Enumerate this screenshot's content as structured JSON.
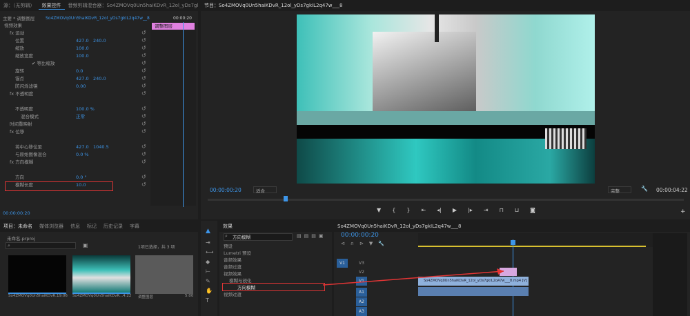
{
  "source_tabs": [
    "源：（无剪辑）",
    "效果控件",
    "音频剪辑混合器：So4ZMOVq0Un5haiKDvR_12ol_yDs7gk"
  ],
  "ec": {
    "master": "主要 * 调整图层",
    "clip": "So4ZMOVq0Un5haiKDvR_12ol_yDs7gkIL2q47w__8",
    "time_start": "00:00",
    "time_end": "00:00:20",
    "bar_label": "调整图层",
    "rows": [
      {
        "t": "视频效果",
        "i": 0,
        "v1": "",
        "v2": ""
      },
      {
        "t": "fx 运动",
        "i": 1,
        "v1": "",
        "v2": ""
      },
      {
        "t": "位置",
        "i": 2,
        "v1": "427.0",
        "v2": "240.0"
      },
      {
        "t": "缩放",
        "i": 2,
        "v1": "100.0",
        "v2": ""
      },
      {
        "t": "缩放宽度",
        "i": 2,
        "v1": "100.0",
        "v2": ""
      },
      {
        "t": "✔ 等比缩放",
        "i": 5,
        "v1": "",
        "v2": ""
      },
      {
        "t": "旋转",
        "i": 2,
        "v1": "0.0",
        "v2": ""
      },
      {
        "t": "锚点",
        "i": 2,
        "v1": "427.0",
        "v2": "240.0"
      },
      {
        "t": "防闪烁滤镜",
        "i": 2,
        "v1": "0.00",
        "v2": ""
      },
      {
        "t": "fx 不透明度",
        "i": 1,
        "v1": "",
        "v2": ""
      },
      {
        "t": "",
        "i": 2,
        "v1": "",
        "v2": ""
      },
      {
        "t": "不透明度",
        "i": 2,
        "v1": "100.0 %",
        "v2": ""
      },
      {
        "t": "混合模式",
        "i": 3,
        "v1": "正常",
        "v2": ""
      },
      {
        "t": "时间重映射",
        "i": 1,
        "v1": "",
        "v2": ""
      },
      {
        "t": "fx 位移",
        "i": 1,
        "v1": "",
        "v2": ""
      },
      {
        "t": "",
        "i": 2,
        "v1": "",
        "v2": ""
      },
      {
        "t": "将中心移位至",
        "i": 2,
        "v1": "427.0",
        "v2": "1040.5"
      },
      {
        "t": "与原始图像混合",
        "i": 2,
        "v1": "0.0 %",
        "v2": ""
      },
      {
        "t": "fx 方向模糊",
        "i": 1,
        "v1": "",
        "v2": ""
      },
      {
        "t": "",
        "i": 2,
        "v1": "",
        "v2": ""
      },
      {
        "t": "方向",
        "i": 2,
        "v1": "0.0 °",
        "v2": ""
      },
      {
        "t": "模糊长度",
        "i": 2,
        "v1": "10.0",
        "v2": ""
      }
    ],
    "footer_time": "00:00:00:20"
  },
  "program": {
    "title": "节目：So4ZMOVq0Un5haiKDvR_12ol_yDs7gkIL2q47w___8",
    "timecode": "00:00:00:20",
    "fit": "适合",
    "quality": "完整",
    "duration": "00:00:04:22"
  },
  "project": {
    "tabs": [
      "项目：未命名",
      "媒体浏览器",
      "信息",
      "标记",
      "历史记录",
      "字幕"
    ],
    "file": "未命名.prproj",
    "count": "1项已选择，共 3 项",
    "items": [
      {
        "name": "So4ZMOVq0Un5haiKDvR...",
        "dur": "19:06"
      },
      {
        "name": "So4ZMOVq0Un5haiKDvR...",
        "dur": "4:22"
      },
      {
        "name": "调整图层",
        "dur": "5:00"
      }
    ]
  },
  "effects": {
    "title": "效果",
    "search": "方向模糊",
    "tree": [
      {
        "t": "预设",
        "i": 0
      },
      {
        "t": "Lumetri 预设",
        "i": 0
      },
      {
        "t": "音频效果",
        "i": 0
      },
      {
        "t": "音频过渡",
        "i": 0
      },
      {
        "t": "视频效果",
        "i": 0
      },
      {
        "t": "模糊与锐化",
        "i": 1
      },
      {
        "t": "方向模糊",
        "i": 2
      },
      {
        "t": "视频过渡",
        "i": 0
      }
    ]
  },
  "timeline": {
    "tab": "So4ZMOVq0Un5haiKDvR_12ol_yDs7gkIL2q47w___8",
    "timecode": "00:00:00:20",
    "tracks": [
      "V3",
      "V2",
      "V1",
      "A1",
      "A2",
      "A3"
    ],
    "clip": "So4ZMOVq0Un5haiKDvR_12ol_yDs7gkIL2q47w___8.mp4 [V]"
  },
  "colors": {
    "accent": "#3d95e8",
    "highlight": "#e33535",
    "adjust": "#e080e0"
  }
}
